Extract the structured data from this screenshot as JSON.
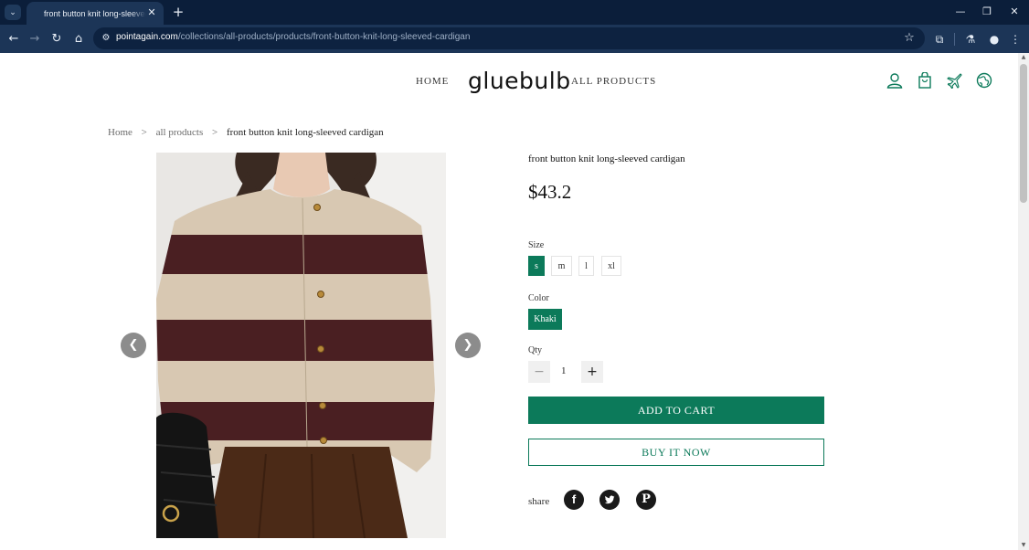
{
  "browser": {
    "tab_title": "front button knit long-sleeved cardigan",
    "url_host": "pointagain.com",
    "url_path": "/collections/all-products/products/front-button-knit-long-sleeved-cardigan"
  },
  "header": {
    "nav_home": "HOME",
    "logo": "gluebulb",
    "nav_all_products": "ALL PRODUCTS"
  },
  "breadcrumb": {
    "home": "Home",
    "collection": "all products",
    "current": "front button knit long-sleeved cardigan",
    "separator": ">"
  },
  "product": {
    "title": "front button knit long-sleeved cardigan",
    "price": "$43.2",
    "size_label": "Size",
    "sizes": [
      "s",
      "m",
      "l",
      "xl"
    ],
    "selected_size": "s",
    "color_label": "Color",
    "color": "Khaki",
    "qty_label": "Qty",
    "qty": "1",
    "add_to_cart": "ADD TO CART",
    "buy_now": "BUY IT NOW",
    "share_label": "share"
  },
  "colors": {
    "accent": "#0c7a5a",
    "browser_dark": "#0b1e3a"
  },
  "icons": [
    "user-icon",
    "bag-icon",
    "plane-icon",
    "globe-icon",
    "facebook-icon",
    "twitter-icon",
    "pinterest-icon"
  ]
}
